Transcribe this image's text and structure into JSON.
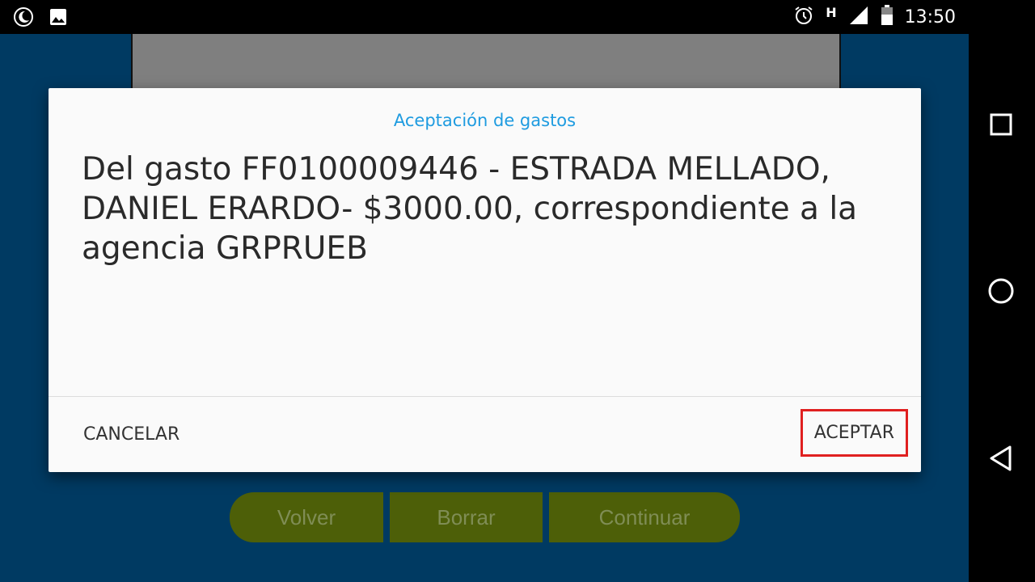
{
  "status_bar": {
    "time": "13:50",
    "network_letter": "H",
    "icons": [
      "night-mode-icon",
      "image-icon",
      "alarm-icon",
      "signal-icon",
      "battery-icon"
    ]
  },
  "nav_bar": {
    "icons": [
      "recents-square-icon",
      "home-circle-icon",
      "back-triangle-icon"
    ]
  },
  "app": {
    "buttons": [
      "Volver",
      "Borrar",
      "Continuar"
    ],
    "background_color": "#003a62",
    "button_color": "#4d5f08"
  },
  "dialog": {
    "title": "Aceptación de gastos",
    "message": "Del gasto FF0100009446 - ESTRADA MELLADO, DANIEL ERARDO- $3000.00, correspondiente a la agencia GRPRUEB",
    "cancel_label": "CANCELAR",
    "accept_label": "ACEPTAR",
    "title_color": "#1e9be0",
    "highlight_color": "#e02020"
  }
}
